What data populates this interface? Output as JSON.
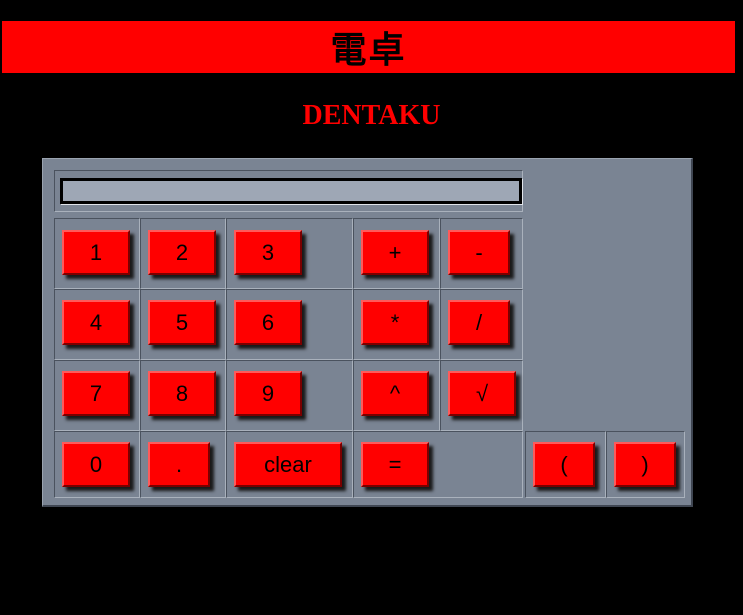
{
  "header": {
    "title": "電卓",
    "subtitle": "DENTAKU"
  },
  "display": {
    "value": ""
  },
  "buttons": {
    "b1": "1",
    "b2": "2",
    "b3": "3",
    "plus": "+",
    "minus": "-",
    "b4": "4",
    "b5": "5",
    "b6": "6",
    "multiply": "*",
    "divide": "/",
    "b7": "7",
    "b8": "8",
    "b9": "9",
    "power": "^",
    "sqrt": "√",
    "b0": "0",
    "dot": ".",
    "clear": "clear",
    "equals": "=",
    "lparen": "(",
    "rparen": ")"
  },
  "colors": {
    "background": "#000000",
    "accent": "#ff0000",
    "panel": "#7a8493",
    "display": "#9ea7b5"
  }
}
